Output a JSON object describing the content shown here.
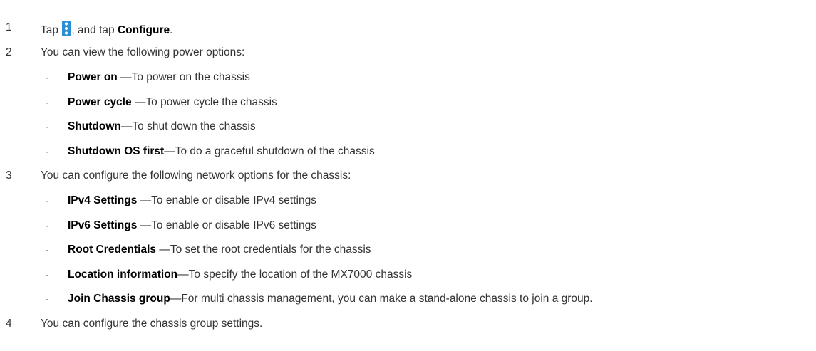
{
  "steps": [
    {
      "num": "1",
      "parts": {
        "a": "Tap ",
        "icon": "kebab-menu-icon",
        "b": ", and tap ",
        "bold": "Configure",
        "c": "."
      }
    },
    {
      "num": "2",
      "text": "You can view the following power options:",
      "bullets": [
        {
          "bullet": "·",
          "term": "Power on ",
          "desc": "—To power on the chassis"
        },
        {
          "bullet": "·",
          "term": "Power cycle ",
          "desc": "—To power cycle the chassis"
        },
        {
          "bullet": "·",
          "term": "Shutdown",
          "desc": "—To shut down the chassis"
        },
        {
          "bullet": "·",
          "term": "Shutdown OS first",
          "desc": "—To do a graceful shutdown of the chassis"
        }
      ]
    },
    {
      "num": "3",
      "text": "You can configure the following network options for the chassis:",
      "bullets": [
        {
          "bullet": "·",
          "term": "IPv4 Settings ",
          "desc": "—To enable or disable IPv4 settings"
        },
        {
          "bullet": "·",
          "term": "IPv6 Settings ",
          "desc": "—To enable or disable IPv6 settings"
        },
        {
          "bullet": "·",
          "term": "Root Credentials ",
          "desc": "—To set the root credentials for the chassis"
        },
        {
          "bullet": "·",
          "term": "Location information",
          "desc": "—To specify the location of the MX7000 chassis"
        },
        {
          "bullet": "·",
          "term": "Join Chassis group",
          "desc": "—For multi chassis management, you can make a stand-alone chassis to join a group."
        }
      ]
    },
    {
      "num": "4",
      "text": "You can configure the chassis group settings."
    }
  ],
  "colors": {
    "icon_blue": "#2b8fd6",
    "text": "#333333",
    "bold": "#000000"
  }
}
